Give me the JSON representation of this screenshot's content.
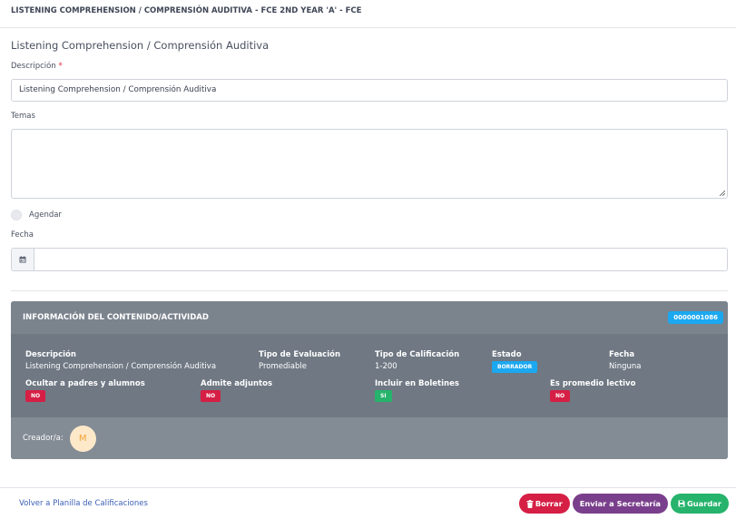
{
  "header": {
    "title": "LISTENING COMPREHENSION / COMPRENSIÓN AUDITIVA - FCE 2ND YEAR 'A' - FCE"
  },
  "form": {
    "section_title": "Listening Comprehension / Comprensión Auditiva",
    "descripcion_label": "Descripción",
    "required_mark": "*",
    "descripcion_value": "Listening Comprehension / Comprensión Auditiva",
    "temas_label": "Temas",
    "temas_value": "",
    "agendar_label": "Agendar",
    "fecha_label": "Fecha",
    "fecha_value": ""
  },
  "info_card": {
    "title": "INFORMACIÓN DEL CONTENIDO/ACTIVIDAD",
    "code": "0000001086",
    "fields": {
      "descripcion": {
        "label": "Descripción",
        "value": "Listening Comprehension / Comprensión Auditiva"
      },
      "tipo_evaluacion": {
        "label": "Tipo de Evaluación",
        "value": "Promediable"
      },
      "tipo_calificacion": {
        "label": "Tipo de Calificación",
        "value": "1-200"
      },
      "estado": {
        "label": "Estado",
        "value": "BORRADOR"
      },
      "fecha": {
        "label": "Fecha",
        "value": "Ninguna"
      },
      "ocultar": {
        "label": "Ocultar a padres y alumnos",
        "value": "NO"
      },
      "adjuntos": {
        "label": "Admite adjuntos",
        "value": "NO"
      },
      "boletines": {
        "label": "Incluir en Boletines",
        "value": "SI"
      },
      "promedio": {
        "label": "Es promedio lectivo",
        "value": "NO"
      }
    },
    "creator_label": "Creador/a:",
    "creator_initial": "M"
  },
  "footer": {
    "back_link": "Volver a Planilla de Calificaciones",
    "delete_label": "Borrar",
    "send_label": "Enviar a Secretaría",
    "save_label": "Guardar"
  },
  "colors": {
    "danger": "#d61f45",
    "success": "#26b36b",
    "info": "#1ba8f0",
    "purple": "#7a3f8c",
    "card": "#6f7883"
  },
  "icons": [
    "calendar-icon",
    "trash-icon",
    "save-icon"
  ]
}
